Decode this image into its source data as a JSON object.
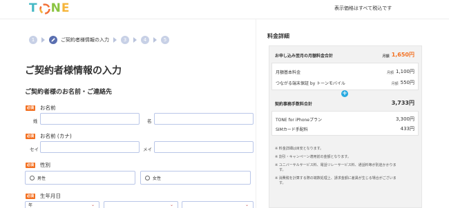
{
  "header": {
    "logo_text": "TONE",
    "tax_note": "表示価格はすべて税込です",
    "logo_colors": [
      "#44b8c4",
      "#f27036",
      "#f6b53b",
      "#8ac441"
    ]
  },
  "steps": {
    "items": [
      "1",
      "2",
      "3",
      "4",
      "5"
    ],
    "active_label": "ご契約者様情報の入力"
  },
  "form": {
    "page_title": "ご契約者様情報の入力",
    "section_title": "ご契約者様のお名前・ご連絡先",
    "required_badge": "必須",
    "name": {
      "label": "お名前",
      "last": "姓",
      "first": "名"
    },
    "kana": {
      "label": "お名前 (カナ)",
      "last": "セイ",
      "first": "メイ"
    },
    "gender": {
      "label": "性別",
      "male": "男性",
      "female": "女性"
    },
    "birthday": {
      "label": "生年月日",
      "year": "年"
    }
  },
  "pricing": {
    "title": "料金詳細",
    "monthly_total": {
      "label": "お申し込み翌月の月額料金合計",
      "unit": "月額",
      "value": "1,650円"
    },
    "monthly_items": [
      {
        "label": "月額基本料金",
        "unit": "月額",
        "value": "1,100円"
      },
      {
        "label": "つながる端末保証 by トーンモバイル",
        "unit": "月額",
        "value": "550円"
      }
    ],
    "fees_total": {
      "label": "契約事務手数料合計",
      "value": "3,733円"
    },
    "fee_items": [
      {
        "label": "TONE for iPhoneプラン",
        "value": "3,300円"
      },
      {
        "label": "SIMカード手配料",
        "value": "433円"
      }
    ],
    "notes": [
      "※ 料金詳細は目安となります。",
      "※ 割引・キャンペーン適用前の金額となります。",
      "※ ユニバーサルサービス料、電話リレーサービス料、通話料等が別途かかりま",
      "す。",
      "※ 消費税を計算する際の端数処理上、請求金額に差異が生じる場合がございま",
      "す。"
    ]
  }
}
